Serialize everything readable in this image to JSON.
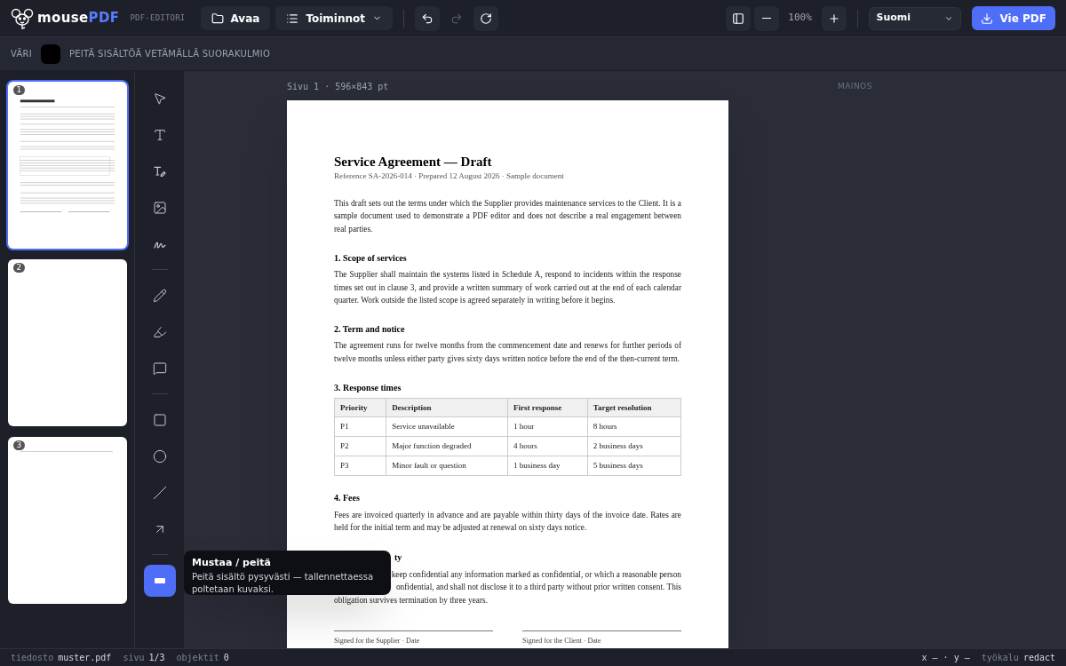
{
  "app": {
    "logo_prefix": "mouse",
    "logo_suffix": "PDF",
    "subtitle": "PDF-EDITORI"
  },
  "toolbar": {
    "open": "Avaa",
    "actions": "Toiminnot",
    "undo_disabled": false,
    "redo_disabled": true,
    "zoom": "100%",
    "language": "Suomi",
    "export": "Vie PDF"
  },
  "options_bar": {
    "color_label": "VÄRI",
    "color": "#000000",
    "hint": "PEITÄ SISÄLTÖÄ VETÄMÄLLÄ SUORAKULMIO"
  },
  "thumbnails": [
    {
      "number": "1",
      "selected": true,
      "kind": "content"
    },
    {
      "number": "2",
      "selected": false,
      "kind": "blank"
    },
    {
      "number": "3",
      "selected": false,
      "kind": "line"
    }
  ],
  "tool_groups": [
    [
      {
        "selected": false
      },
      {
        "selected": false
      },
      {
        "selected": false
      },
      {
        "selected": false
      },
      {
        "selected": false
      }
    ],
    [
      {
        "selected": false
      },
      {
        "selected": false
      },
      {
        "selected": false
      }
    ],
    [
      {
        "selected": false
      },
      {
        "selected": false
      },
      {
        "selected": false
      },
      {
        "selected": false
      }
    ],
    [
      {
        "selected": true
      }
    ]
  ],
  "tooltip": {
    "title": "Mustaa / peitä",
    "text": "Peitä sisältö pysyvästi — tallennettaessa poltetaan kuvaksi."
  },
  "page_label": "Sivu 1 · 596×843 pt",
  "ad_label": "MAINOS",
  "document": {
    "title": "Service Agreement — Draft",
    "meta": "Reference SA-2026-014 · Prepared 12 August 2026 · Sample document",
    "intro": "This draft sets out the terms under which the Supplier provides maintenance services to the Client. It is a sample document used to demonstrate a PDF editor and does not describe a real engagement between real parties.",
    "sections": [
      {
        "heading": "1. Scope of services",
        "text": "The Supplier shall maintain the systems listed in Schedule A, respond to incidents within the response times set out in clause 3, and provide a written summary of work carried out at the end of each calendar quarter. Work outside the listed scope is agreed separately in writing before it begins."
      },
      {
        "heading": "2. Term and notice",
        "text": "The agreement runs for twelve months from the commencement date and renews for further periods of twelve months unless either party gives sixty days written notice before the end of the then-current term."
      },
      {
        "heading": "3. Response times",
        "table": {
          "columns": [
            "Priority",
            "Description",
            "First response",
            "Target resolution"
          ],
          "rows": [
            [
              "P1",
              "Service unavailable",
              "1 hour",
              "8 hours"
            ],
            [
              "P2",
              "Major function degraded",
              "4 hours",
              "2 business days"
            ],
            [
              "P3",
              "Minor fault or question",
              "1 business day",
              "5 business days"
            ]
          ]
        }
      },
      {
        "heading": "4. Fees",
        "text": "Fees are invoiced quarterly in advance and are payable within thirty days of the invoice date. Rates are held for the initial term and may be adjusted at renewal on sixty days notice."
      }
    ],
    "covered_section": {
      "heading_tail": "ty",
      "line_tails": [
        "keep confidential any information marked as confidential, or which a reasonable person",
        "onfidential, and shall not disclose it to a third party without prior written consent. This"
      ],
      "last_line": "obligation survives termination by three years."
    },
    "signatures": [
      "Signed for the Supplier · Date",
      "Signed for the Client · Date"
    ]
  },
  "status": {
    "file_label": "tiedosto",
    "file": "muster.pdf",
    "page_label": "sivu",
    "page": "1/3",
    "objects_label": "objektit",
    "objects": "0",
    "coords": "x – · y –",
    "tool_label": "työkalu",
    "tool": "redact"
  }
}
